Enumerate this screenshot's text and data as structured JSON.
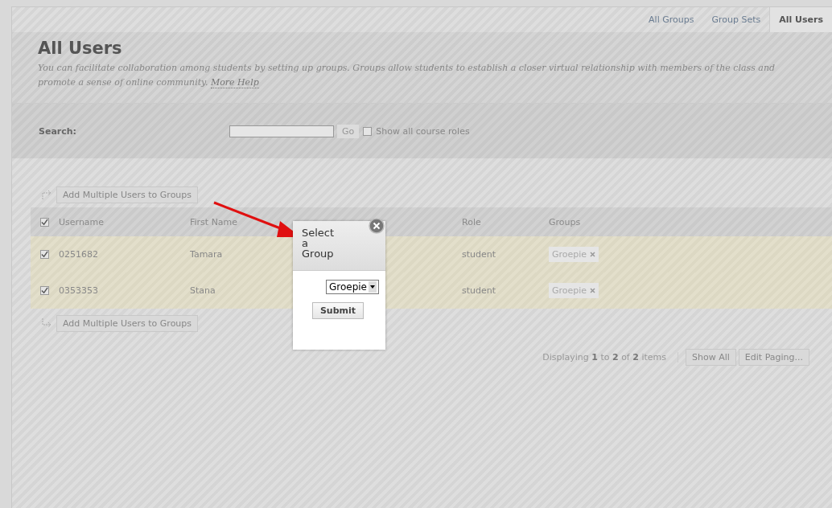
{
  "tabs": [
    {
      "label": "All Groups",
      "selected": false
    },
    {
      "label": "Group Sets",
      "selected": false
    },
    {
      "label": "All Users",
      "selected": true
    }
  ],
  "page_title": "All Users",
  "description": "You can facilitate collaboration among students by setting up groups. Groups allow students to establish a closer virtual relationship with members of the class and promote a sense of online community.",
  "help_link": "More Help",
  "search": {
    "label": "Search:",
    "go_button": "Go",
    "show_all_roles": {
      "label": "Show all course roles",
      "checked": false
    }
  },
  "action_button_top": "Add Multiple Users to Groups",
  "table": {
    "select_all_checked": true,
    "columns": [
      "Username",
      "First Name",
      "Role",
      "Groups"
    ],
    "rows": [
      {
        "checked": true,
        "username": "0251682",
        "first_name": "Tamara",
        "role": "student",
        "group": "Groepie"
      },
      {
        "checked": true,
        "username": "0353353",
        "first_name": "Stana",
        "role": "student",
        "group": "Groepie"
      }
    ]
  },
  "action_button_bottom": "Add Multiple Users to Groups",
  "paging": {
    "summary": "Displaying **1** to **2** of **2** items",
    "show_all": "Show All",
    "edit_paging": "Edit Paging..."
  },
  "popup": {
    "title": "Select a Group",
    "select_value": "Groepie",
    "submit": "Submit"
  }
}
